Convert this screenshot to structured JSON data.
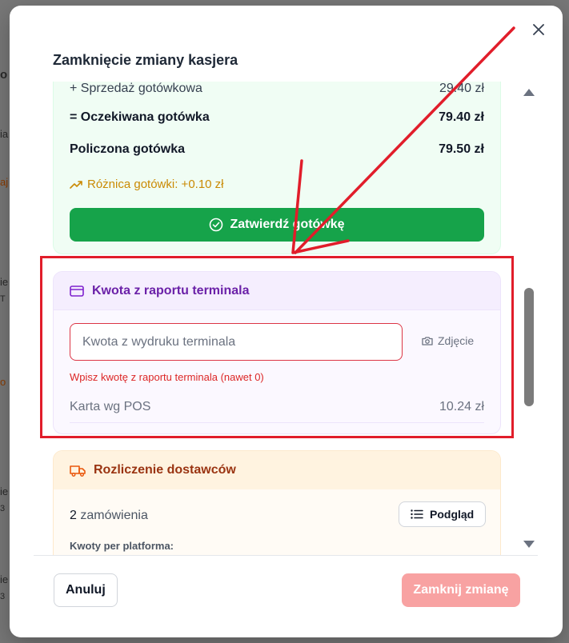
{
  "modal": {
    "title": "Zamknięcie zmiany kasjera",
    "close_icon": "close-icon"
  },
  "cash_section": {
    "cash_sales_label": "+ Sprzedaż gotówkowa",
    "cash_sales_value": "29.40 zł",
    "expected_label": "= Oczekiwana gotówka",
    "expected_value": "79.40 zł",
    "counted_label": "Policzona gotówka",
    "counted_value": "79.50 zł",
    "difference": "Różnica gotówki: +0.10 zł",
    "difference_color": "#ca8a04",
    "confirm_label": "Zatwierdź gotówkę",
    "accent": "#16a34a"
  },
  "terminal_section": {
    "title": "Kwota z raportu terminala",
    "input_placeholder": "Kwota z wydruku terminala",
    "input_value": "",
    "photo_label": "Zdjęcie",
    "error": "Wpisz kwotę z raportu terminala (nawet 0)",
    "card_pos_label": "Karta wg POS",
    "card_pos_value": "10.24 zł",
    "accent": "#6b21a8"
  },
  "supplier_section": {
    "title": "Rozliczenie dostawców",
    "orders_count": "2",
    "orders_label": "zamówienia",
    "preview_label": "Podgląd",
    "per_platform_label": "Kwoty per platforma:",
    "accent": "#ea580c"
  },
  "footer": {
    "cancel_label": "Anuluj",
    "close_shift_label": "Zamknij zmianę",
    "close_shift_color": "#f8a2a2"
  },
  "background": {
    "fragments": [
      "o",
      "ia",
      "aj",
      "ie",
      "T",
      "o",
      "ie",
      "3",
      "ie",
      "3"
    ]
  },
  "annotation": {
    "highlight_color": "#e11d2a"
  }
}
